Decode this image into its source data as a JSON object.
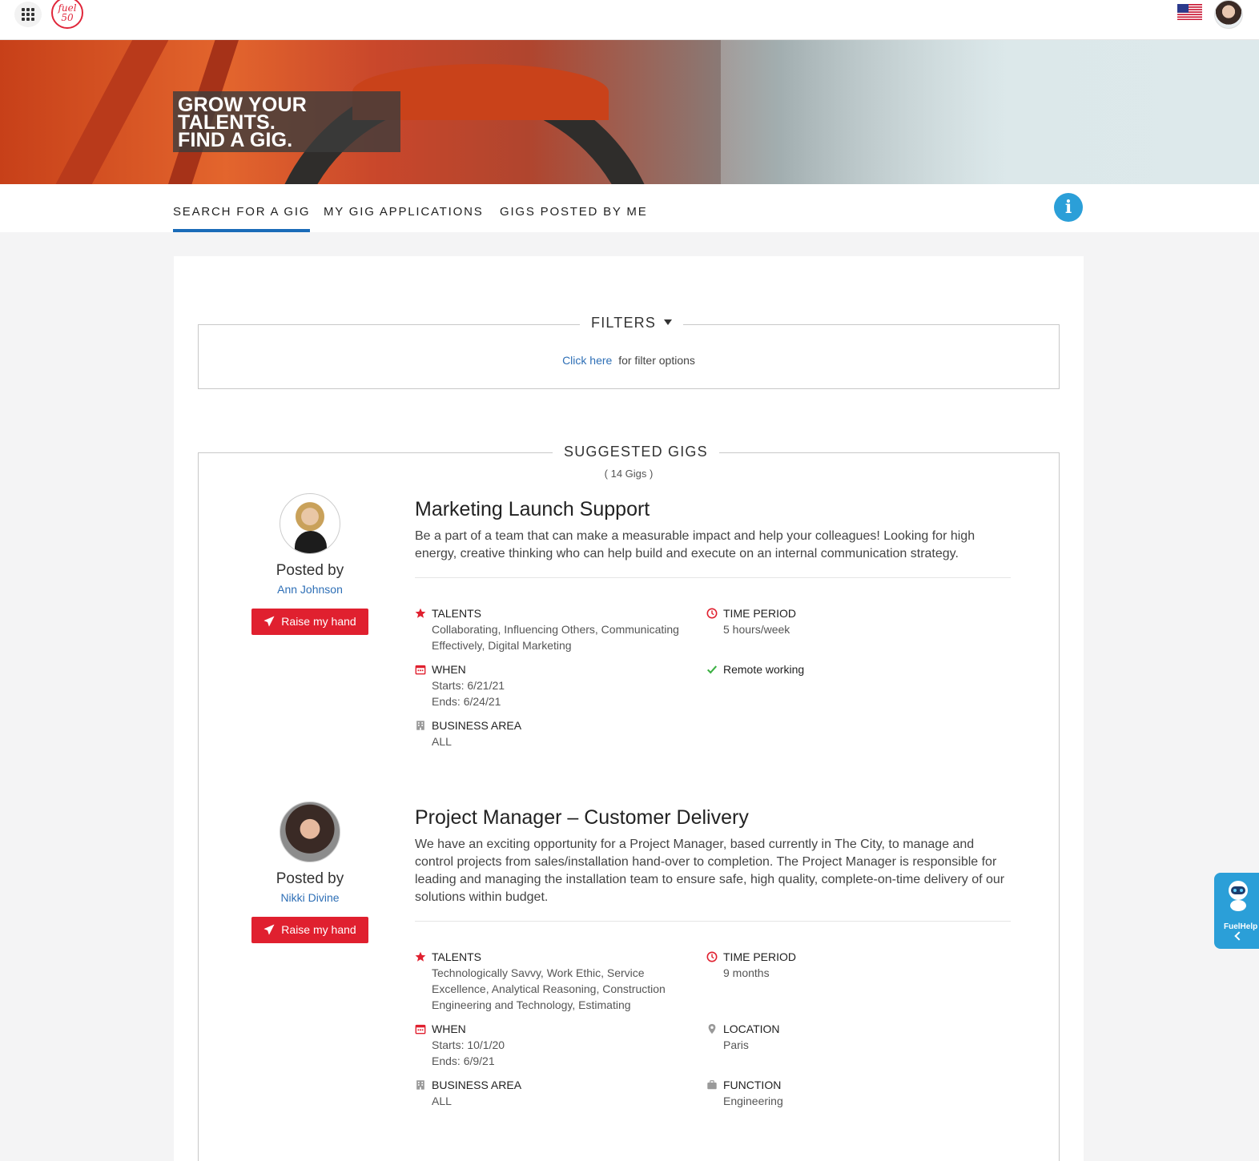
{
  "header": {
    "apps_icon": "apps-grid-icon",
    "logo_text": "fuel 50",
    "flag_icon": "us-flag-icon",
    "avatar_icon": "user-avatar"
  },
  "banner": {
    "line1": "GROW YOUR TALENTS.",
    "line2": "FIND A GIG."
  },
  "tabs": [
    {
      "label": "SEARCH FOR A GIG",
      "active": true
    },
    {
      "label": "MY GIG APPLICATIONS",
      "active": false
    },
    {
      "label": "GIGS POSTED BY ME",
      "active": false
    }
  ],
  "info_icon": "info-icon",
  "filters": {
    "title": "FILTERS",
    "link": "Click here",
    "text": "for filter options"
  },
  "suggested": {
    "title": "SUGGESTED GIGS",
    "count": "( 14 Gigs )"
  },
  "gigs": [
    {
      "posted_by_label": "Posted by",
      "poster": "Ann Johnson",
      "button": "Raise my hand",
      "title": "Marketing Launch Support",
      "description": "Be a part of a team that can make a measurable impact and help your colleagues!   Looking for high energy, creative thinking who can help build and execute on an internal communication strategy.",
      "talents_label": "TALENTS",
      "talents": "Collaborating,  Influencing Others,  Communicating Effectively,  Digital Marketing",
      "time_label": "TIME PERIOD",
      "time": "5 hours/week",
      "when_label": "WHEN",
      "starts": "Starts: 6/21/21",
      "ends": "Ends: 6/24/21",
      "remote": "Remote working",
      "area_label": "BUSINESS AREA",
      "area": "ALL"
    },
    {
      "posted_by_label": "Posted by",
      "poster": "Nikki Divine",
      "button": "Raise my hand",
      "title": "Project Manager – Customer Delivery",
      "description": "We have an exciting opportunity for a Project Manager, based currently in The City, to manage and control projects from sales/installation hand-over to completion.  The Project Manager is responsible for leading and managing the installation team to ensure safe, high quality, complete-on-time delivery of our solutions within budget.",
      "talents_label": "TALENTS",
      "talents": "Technologically Savvy,  Work Ethic,  Service Excellence,  Analytical Reasoning,  Construction Engineering and Technology,  Estimating",
      "time_label": "TIME PERIOD",
      "time": "9 months",
      "when_label": "WHEN",
      "starts": "Starts: 10/1/20",
      "ends": "Ends: 6/9/21",
      "location_label": "LOCATION",
      "location": "Paris",
      "area_label": "BUSINESS AREA",
      "area": "ALL",
      "function_label": "FUNCTION",
      "function": "Engineering"
    }
  ],
  "fuelhelp": {
    "label": "FuelHelp"
  }
}
